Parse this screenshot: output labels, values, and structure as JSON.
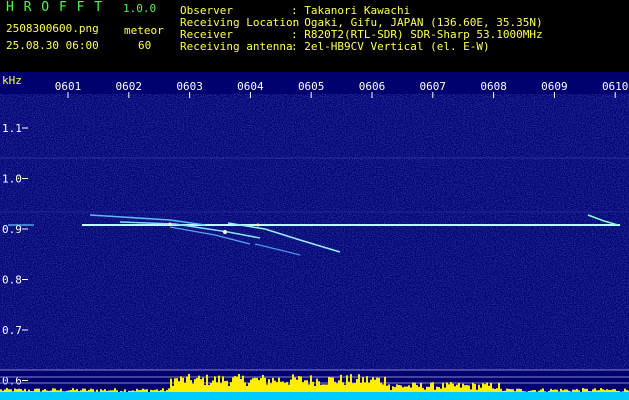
{
  "header": {
    "app_title": "H R O F F T",
    "version": "1.0.0",
    "filename": "2508300600.png",
    "counter_label": "meteor",
    "datetime": "25.08.30 06:00",
    "counter_value": "60",
    "info_rows": [
      {
        "label": "Observer",
        "value": ": Takanori Kawachi"
      },
      {
        "label": "Receiving Location",
        "value": ": Ogaki, Gifu, JAPAN (136.60E, 35.35N)"
      },
      {
        "label": "Receiver",
        "value": ": R820T2(RTL-SDR) SDR-Sharp 53.1000MHz"
      },
      {
        "label": "Receiving antenna",
        "value": ": 2el-HB9CV Vertical (el. E-W)"
      }
    ]
  },
  "spectrogram": {
    "y_unit": "kHz",
    "y_ticks": [
      "1.1",
      "1.0",
      "0.9",
      "0.8",
      "0.7",
      "0.6"
    ],
    "time_ticks": [
      "0601",
      "0602",
      "0603",
      "0604",
      "0605",
      "0606",
      "0607",
      "0608",
      "0609",
      "0610"
    ],
    "colors": {
      "background": "#000080",
      "trace": "#aaffff",
      "label": "#ffff55",
      "activity_fill": "#ffee00",
      "activity_base": "#00ccff"
    }
  }
}
